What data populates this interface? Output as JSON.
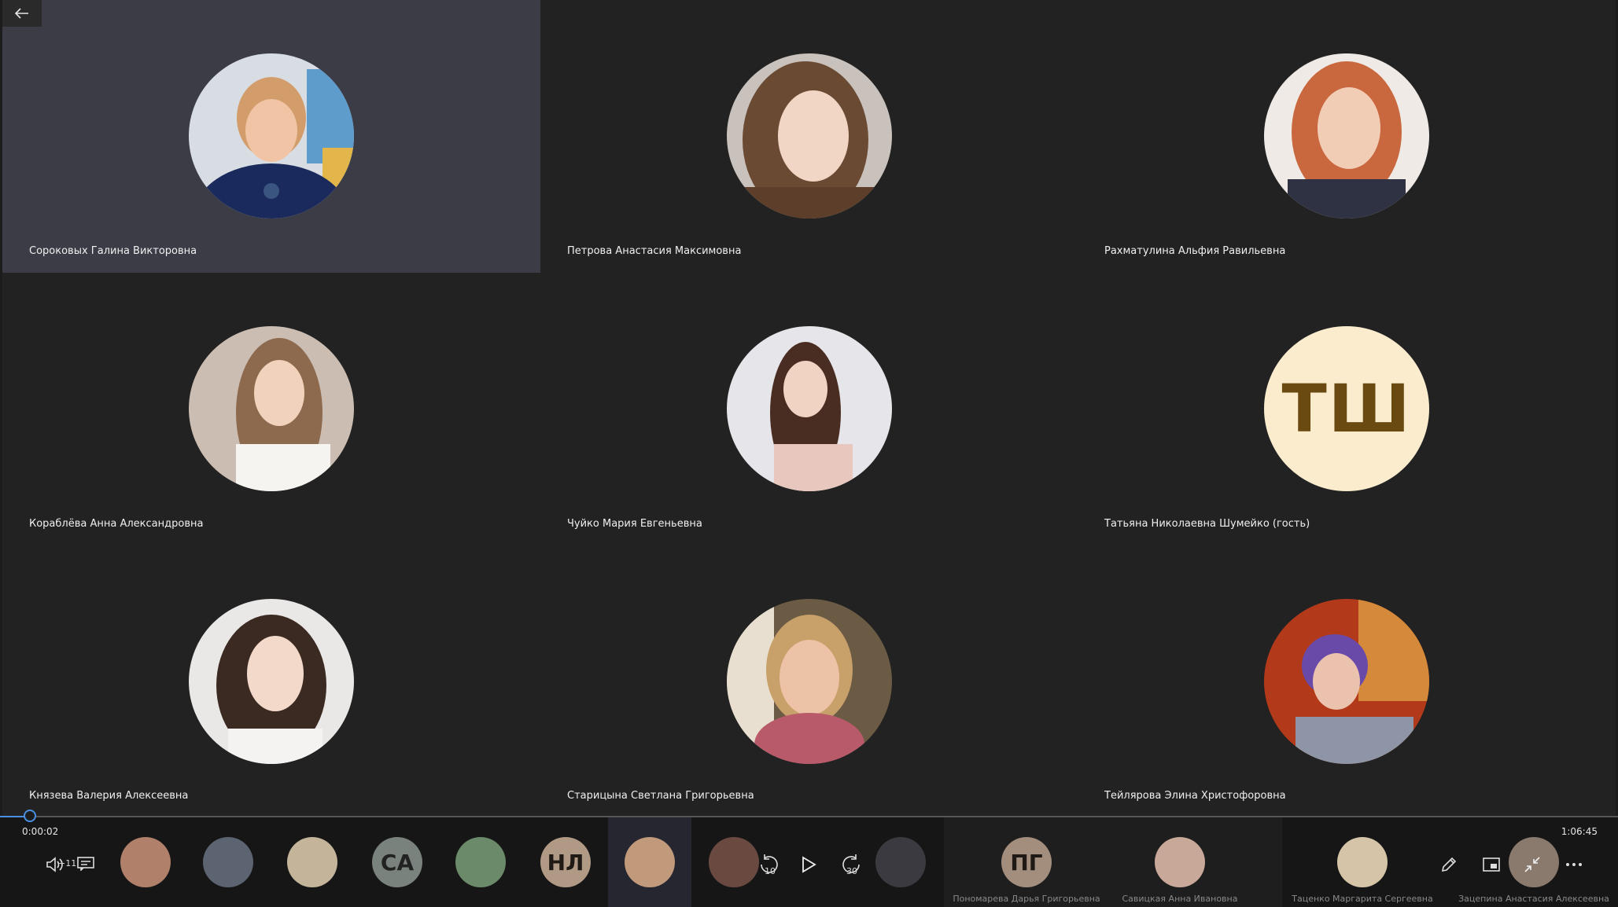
{
  "participants": [
    {
      "name": "Сороковых Галина Викторовна",
      "active": true
    },
    {
      "name": "Петрова Анастасия Максимовна"
    },
    {
      "name": "Рахматулина Альфия Равильевна"
    },
    {
      "name": "Кораблёва Анна Александровна"
    },
    {
      "name": "Чуйко Мария Евгеньевна"
    },
    {
      "name": "Татьяна Николаевна Шумейко (гость)",
      "initials": "ТШ"
    },
    {
      "name": "Князева Валерия Алексеевна"
    },
    {
      "name": "Старицына Светлана Григорьевна"
    },
    {
      "name": "Тейлярова Элина Христофоровна"
    }
  ],
  "player": {
    "current_time": "0:00:02",
    "duration": "1:06:45",
    "progress_fraction": 0.0005,
    "skip_back_label": "10",
    "skip_forward_label": "30",
    "volume_label": "+11"
  },
  "strip": {
    "initials": [
      "СА",
      "НЛ",
      "ПГ"
    ],
    "labels": {
      "ponomareva": "Пономарева Дарья Григорьевна",
      "savitskaya": "Савицкая Анна Ивановна",
      "tatsenko": "Таценко Маргарита Сергеевна",
      "zatsepina": "Зацепина Анастасия Алексеевна"
    }
  },
  "colors": {
    "active_tile": "#3b3c46",
    "tile": "#222222",
    "accent": "#4a90e2",
    "initials_bg": "#fbeccd",
    "initials_fg": "#6a4a10"
  }
}
